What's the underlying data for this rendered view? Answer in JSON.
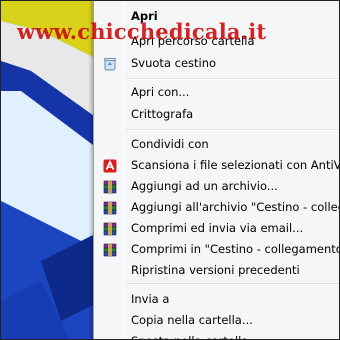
{
  "watermark": {
    "text": "www.chicchedicala.it"
  },
  "menu": {
    "items": [
      {
        "label": "Apri",
        "bold": true,
        "icon": null
      },
      {
        "label": "Apri percorso cartella",
        "icon": null
      },
      {
        "label": "Svuota cestino",
        "icon": "recycle-bin-icon"
      },
      {
        "label": "Apri con...",
        "icon": null
      },
      {
        "label": "Crittografa",
        "icon": null
      },
      {
        "label": "Condividi con",
        "icon": null
      },
      {
        "label": "Scansiona i file selezionati con AntiVir",
        "icon": "antivir-icon"
      },
      {
        "label": "Aggiungi ad un archivio...",
        "icon": "winrar-icon"
      },
      {
        "label": "Aggiungi all'archivio \"Cestino - collegam",
        "icon": "winrar-icon"
      },
      {
        "label": "Comprimi ed invia via email...",
        "icon": "winrar-icon"
      },
      {
        "label": "Comprimi in \"Cestino - collegamento.ra",
        "icon": "winrar-icon"
      },
      {
        "label": "Ripristina versioni precedenti",
        "icon": null
      },
      {
        "label": "Invia a",
        "icon": null
      },
      {
        "label": "Copia nella cartella...",
        "icon": null
      },
      {
        "label": "Sposta nella cartella...",
        "icon": null
      }
    ]
  },
  "colors": {
    "desktop_blue": "#1f4fc8",
    "desktop_yellow": "#d9d21a",
    "watermark": "#cc0000",
    "antivir_red": "#d81e1e"
  }
}
